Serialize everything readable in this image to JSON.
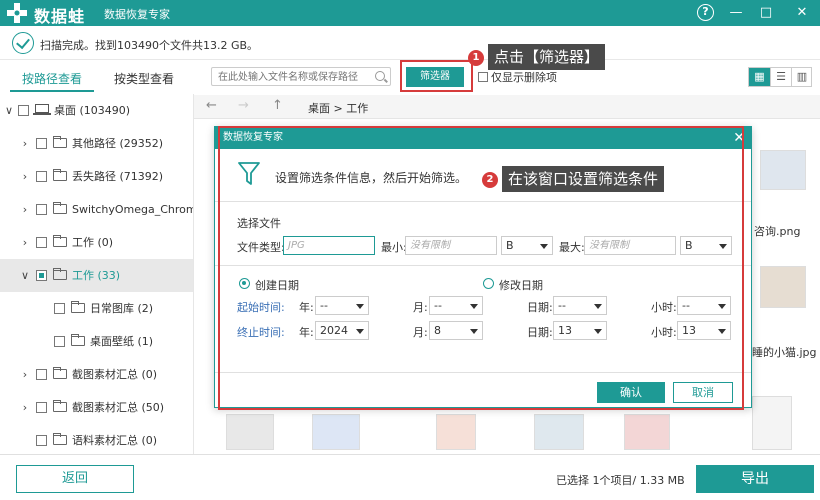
{
  "titlebar": {
    "brand": "数据蛙",
    "subtitle": "数据恢复专家",
    "help_glyph": "?",
    "minimize_glyph": "—",
    "maximize_glyph": "□",
    "close_glyph": "✕"
  },
  "status": {
    "text": "扫描完成。找到103490个文件共13.2 GB。"
  },
  "tabs": [
    {
      "label": "按路径查看",
      "active": true
    },
    {
      "label": "按类型查看",
      "active": false
    }
  ],
  "tree": [
    {
      "label": "桌面 (103490)",
      "arrow": "∨",
      "kind": "pc"
    },
    {
      "label": "其他路径 (29352)",
      "arrow": "›",
      "kind": "folder"
    },
    {
      "label": "丢失路径 (71392)",
      "arrow": "›",
      "kind": "folder"
    },
    {
      "label": "SwitchyOmega_Chromium",
      "arrow": "›",
      "kind": "folder"
    },
    {
      "label": "工作 (0)",
      "arrow": "›",
      "kind": "folder"
    },
    {
      "label": "工作 (33)",
      "arrow": "∨",
      "kind": "folder",
      "selected": true
    },
    {
      "label": "日常图库 (2)",
      "arrow": "",
      "kind": "folder"
    },
    {
      "label": "桌面壁纸 (1)",
      "arrow": "",
      "kind": "folder"
    },
    {
      "label": "截图素材汇总 (0)",
      "arrow": "›",
      "kind": "folder"
    },
    {
      "label": "截图素材汇总 (50)",
      "arrow": "›",
      "kind": "folder"
    },
    {
      "label": "语料素材汇总 (0)",
      "arrow": "",
      "kind": "folder"
    }
  ],
  "search": {
    "placeholder": "在此处输入文件名称或保存路径"
  },
  "toolbar": {
    "filter_label": "筛选器",
    "deleted_only_label": "仅显示删除项",
    "view_icons": [
      "▦",
      "☰",
      "▥"
    ]
  },
  "navbar": {
    "back": "←",
    "forward": "→",
    "up": "↑",
    "breadcrumb": "桌面 > 工作"
  },
  "background_files": {
    "file1": "咨询.png",
    "file2": "睡的小猫.jpg"
  },
  "dialog": {
    "title": "数据恢复专家",
    "close_glyph": "✕",
    "hint": "设置筛选条件信息，然后开始筛选。",
    "section_label": "选择文件",
    "file_type_label": "文件类型:",
    "file_type_placeholder": "JPG",
    "min_label": "最小:",
    "min_placeholder": "没有限制",
    "min_unit": "B",
    "max_label": "最大:",
    "max_placeholder": "没有限制",
    "max_unit": "B",
    "created_label": "创建日期",
    "modified_label": "修改日期",
    "start_label": "起始时间:",
    "end_label": "终止时间:",
    "year_label": "年:",
    "month_label": "月:",
    "day_label": "日期:",
    "hour_label": "小时:",
    "start": {
      "year": "--",
      "month": "--",
      "day": "--",
      "hour": "--"
    },
    "end": {
      "year": "2024",
      "month": "8",
      "day": "13",
      "hour": "13"
    },
    "ok_label": "确认",
    "cancel_label": "取消"
  },
  "callouts": [
    {
      "number": "1",
      "text": "点击【筛选器】"
    },
    {
      "number": "2",
      "text": "在该窗口设置筛选条件"
    }
  ],
  "bottom": {
    "back_label": "返回",
    "selection_info": "已选择 1个项目/ 1.33 MB",
    "export_label": "导出"
  },
  "colors": {
    "accent": "#1e9a95",
    "highlight": "#d63b3b"
  }
}
